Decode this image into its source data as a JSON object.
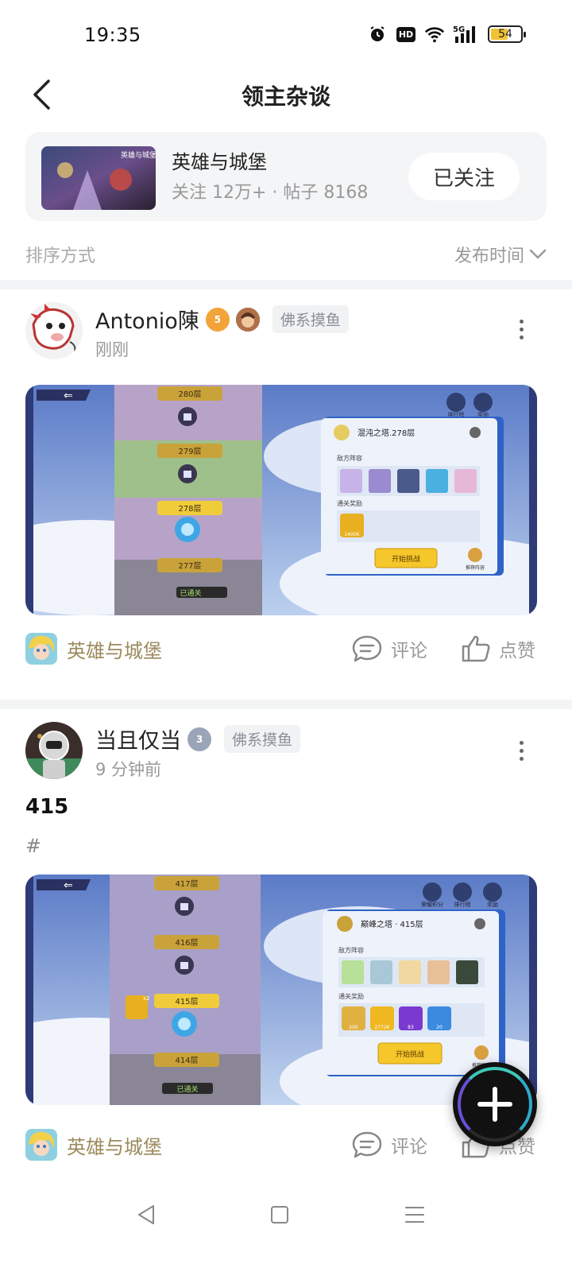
{
  "status_bar": {
    "time": "19:35",
    "hd_label": "HD",
    "network_label": "5G",
    "battery": "54"
  },
  "header": {
    "title": "领主杂谈"
  },
  "community": {
    "name": "英雄与城堡",
    "stats": "关注 12万+ · 帖子 8168",
    "follow_label": "已关注",
    "cover_text": "英雄与城堡"
  },
  "sort": {
    "label": "排序方式",
    "value": "发布时间"
  },
  "posts": [
    {
      "author": "Antonio陳",
      "level_badge": "5",
      "tag": "佛系摸鱼",
      "time": "刚刚",
      "text": "",
      "image": {
        "tower_title": "混沌之塔.278层",
        "floors": [
          "280层",
          "279层",
          "278层",
          "277层"
        ],
        "enemy_label": "敌方阵容",
        "reward_label": "通关奖励",
        "challenge_btn": "开始挑战",
        "cleared_label": "已通关",
        "top_icons": [
          "排行榜",
          "奖励"
        ],
        "recommend_label": "推荐阵容",
        "reward_values": [
          "1400K"
        ]
      },
      "footer": {
        "community": "英雄与城堡",
        "comment": "评论",
        "like": "点赞"
      }
    },
    {
      "author": "当且仅当",
      "level_badge": "3",
      "tag": "佛系摸鱼",
      "time": "9 分钟前",
      "text": "415",
      "hashtag": "#",
      "image": {
        "tower_title": "巅峰之塔 · 415层",
        "floors": [
          "417层",
          "416层",
          "415层",
          "414层"
        ],
        "enemy_label": "敌方阵容",
        "reward_label": "通关奖励",
        "challenge_btn": "开始挑战",
        "cleared_label": "已通关",
        "top_icons": [
          "荣耀积分",
          "排行榜",
          "奖励"
        ],
        "recommend_label": "推荐阵容",
        "reward_values": [
          "200",
          "2772K",
          "83",
          "20"
        ],
        "multiplier": "x2"
      },
      "footer": {
        "community": "英雄与城堡",
        "comment": "评论",
        "like": "点赞"
      }
    }
  ]
}
